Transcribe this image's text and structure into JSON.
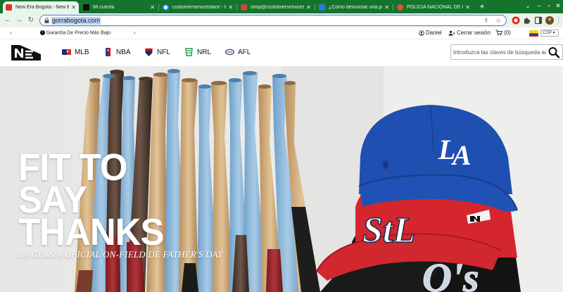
{
  "browser": {
    "tabs": [
      {
        "title": "New Era Bogota - New Era",
        "favicon_color": "#d2362b",
        "active": true
      },
      {
        "title": "Mi cuenta",
        "favicon_color": "#111111",
        "active": false
      },
      {
        "title": "customerservicesface - Bus",
        "favicon_color": "#4285f4",
        "active": false
      },
      {
        "title": "shop@customerservicesfa",
        "favicon_color": "#c4483c",
        "active": false
      },
      {
        "title": "¿Cómo denunciar una pá",
        "favicon_color": "#2a7bd3",
        "active": false
      },
      {
        "title": "POLICÍA NACIONAL DE CO",
        "favicon_color": "#e84c3d",
        "active": false
      }
    ],
    "new_tab_label": "+",
    "url": "gorrabogota.com"
  },
  "topbar": {
    "promo": "Garantía De Precio Más Bajo",
    "user_name": "Daniel",
    "logout_label": "Cerrar sesión",
    "cart_count": "(0)",
    "currency": "COP"
  },
  "header": {
    "leagues": [
      {
        "label": "MLB",
        "icon": "mlb-icon"
      },
      {
        "label": "NBA",
        "icon": "nba-icon"
      },
      {
        "label": "NFL",
        "icon": "nfl-icon"
      },
      {
        "label": "NRL",
        "icon": "nrl-icon"
      },
      {
        "label": "AFL",
        "icon": "afl-icon"
      }
    ],
    "search_placeholder": "Introduzca las claves de búsqueda aquí"
  },
  "hero": {
    "line1": "FIT TO",
    "line2": "SAY",
    "line3": "THANKS",
    "subtitle": "LA GORRA OFICIAL ON-FIELD DE FATHER'S DAY",
    "cap_logos": [
      "LA",
      "StL",
      "O's"
    ]
  },
  "colors": {
    "tabbar": "#14742c",
    "toolbar": "#e9f4ea",
    "dodgers_blue": "#1f4fb0",
    "cardinals_red": "#d5262e",
    "orioles_black": "#141414",
    "bat_blue": "#8db7d8"
  }
}
